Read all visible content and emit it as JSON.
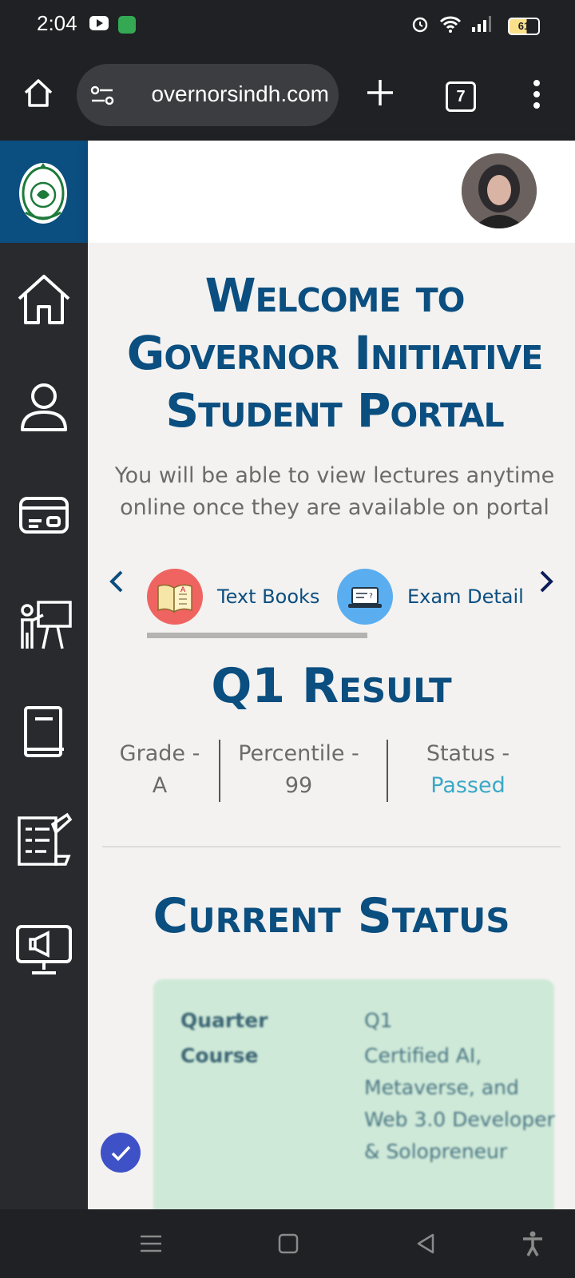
{
  "status_bar": {
    "time": "2:04",
    "battery": "61"
  },
  "browser": {
    "url": "overnorsindh.com",
    "tab_count": "7"
  },
  "welcome": {
    "title": "Welcome to Governor Initiative Student Portal",
    "subtitle": "You will be able to view lectures anytime online once they are available on portal"
  },
  "quick_links": [
    {
      "label": "Text Books",
      "icon": "text-books-icon",
      "color": "#ef6461"
    },
    {
      "label": "Exam Detail",
      "icon": "exam-detail-icon",
      "color": "#5aaef0"
    }
  ],
  "result": {
    "title": "Q1 Result",
    "grade_label": "Grade -",
    "grade_value": "A",
    "percentile_label": "Percentile -",
    "percentile_value": "99",
    "status_label": "Status -",
    "status_value": "Passed"
  },
  "current_status": {
    "title": "Current Status",
    "quarter_label": "Quarter",
    "quarter_value": "Q1",
    "course_label": "Course",
    "course_value": "Certified AI, Metaverse, and Web 3.0 Developer & Solopreneur"
  },
  "sidebar": [
    "home-icon",
    "profile-icon",
    "id-card-icon",
    "teacher-icon",
    "book-icon",
    "assignment-icon",
    "announcement-icon"
  ],
  "colors": {
    "brand_blue": "#0b4e80",
    "sidebar_bg": "#282a2e",
    "accent_passed": "#3aa9c8",
    "card_bg": "#cfe9d8"
  }
}
